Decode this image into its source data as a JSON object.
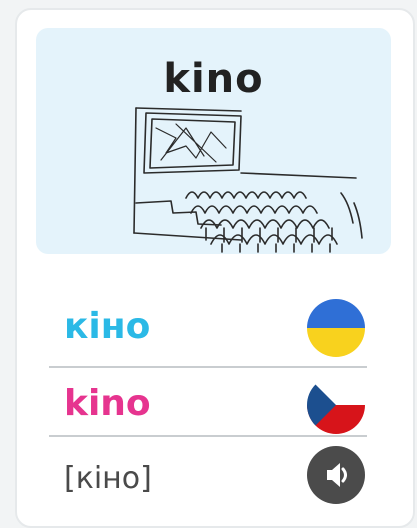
{
  "hero": {
    "word": "kino",
    "image_icon": "cinema-illustration-icon"
  },
  "rows": [
    {
      "text": "кіно",
      "color": "#2bb9e6",
      "icon": "ukraine-flag-icon"
    },
    {
      "text": "kino",
      "color": "#e6348f",
      "icon": "czech-flag-icon"
    },
    {
      "text": "[кіно]",
      "color": "#4a4a4a",
      "icon": "speaker-icon"
    }
  ],
  "colors": {
    "hero_bg": "#e4f3fb",
    "separator": "#c9cdd0",
    "audio_button": "#4b4b4b"
  }
}
